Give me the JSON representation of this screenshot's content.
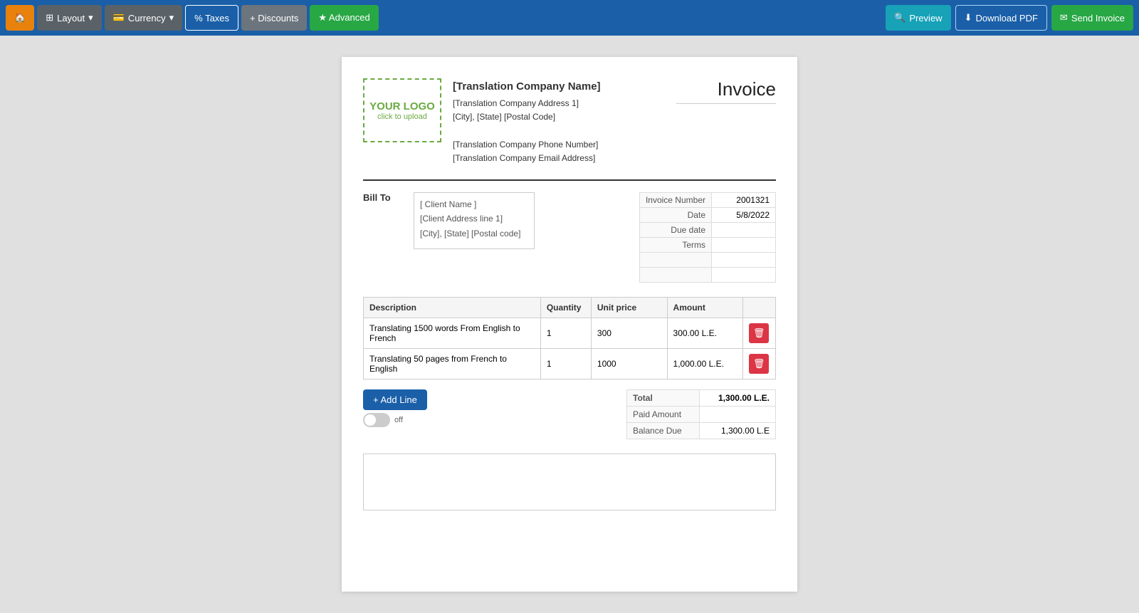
{
  "toolbar": {
    "home_label": "🏠",
    "layout_label": "Layout",
    "currency_label": "Currency",
    "taxes_label": "% Taxes",
    "discounts_label": "+ Discounts",
    "advanced_label": "★ Advanced",
    "preview_label": "Preview",
    "download_label": "Download PDF",
    "send_label": "Send Invoice"
  },
  "invoice": {
    "logo_text": "YOUR LOGO",
    "logo_sub": "click to upload",
    "company_name": "[Translation Company Name]",
    "company_address1": "[Translation Company Address 1]",
    "company_city": "[City], [State] [Postal Code]",
    "company_phone": "[Translation Company Phone Number]",
    "company_email": "[Translation Company Email Address]",
    "title": "Invoice",
    "bill_to_label": "Bill To",
    "client_name": "[ Client Name ]",
    "client_address": "[Client Address line 1]",
    "client_city": "[City], [State] [Postal code]",
    "details": {
      "invoice_number_label": "Invoice Number",
      "invoice_number_value": "2001321",
      "date_label": "Date",
      "date_value": "5/8/2022",
      "due_date_label": "Due date",
      "due_date_value": "",
      "terms_label": "Terms",
      "terms_value": "",
      "row5_label": "",
      "row5_value": "",
      "row6_label": "",
      "row6_value": ""
    },
    "table": {
      "col_description": "Description",
      "col_quantity": "Quantity",
      "col_unit_price": "Unit price",
      "col_amount": "Amount",
      "rows": [
        {
          "description": "Translating 1500 words From English to French",
          "quantity": "1",
          "unit_price": "300",
          "amount": "300.00 L.E."
        },
        {
          "description": "Translating 50 pages from French to English",
          "quantity": "1",
          "unit_price": "1000",
          "amount": "1,000.00 L.E."
        }
      ]
    },
    "add_line_label": "+ Add Line",
    "toggle_label": "off",
    "totals": {
      "total_label": "Total",
      "total_value": "1,300.00 L.E.",
      "paid_label": "Paid Amount",
      "paid_value": "",
      "balance_label": "Balance Due",
      "balance_value": "1,300.00 L.E"
    }
  }
}
